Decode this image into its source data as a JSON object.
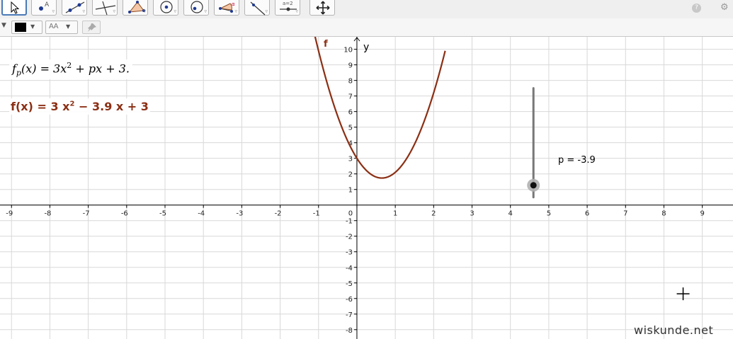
{
  "toolbar": {
    "tools": [
      {
        "name": "move-tool",
        "icon": "cursor-arrow-icon",
        "active": true
      },
      {
        "name": "point-tool",
        "icon": "point-icon"
      },
      {
        "name": "line-tool",
        "icon": "line-through-points-icon"
      },
      {
        "name": "perpendicular-tool",
        "icon": "perpendicular-line-icon"
      },
      {
        "name": "polygon-tool",
        "icon": "polygon-icon"
      },
      {
        "name": "circle-tool",
        "icon": "circle-center-point-icon"
      },
      {
        "name": "circle-three-points-tool",
        "icon": "circle-icon"
      },
      {
        "name": "angle-tool",
        "icon": "angle-icon"
      },
      {
        "name": "reflect-tool",
        "icon": "reflect-line-icon"
      },
      {
        "name": "slider-tool",
        "icon": "slider-icon"
      },
      {
        "name": "move-graphics-tool",
        "icon": "move-arrows-icon"
      }
    ],
    "help_symbol": "?",
    "settings_symbol": "⚙"
  },
  "stylebar": {
    "toggle_symbol": "▼",
    "color": "#000000",
    "text_style_label": "AA",
    "caret": "▼",
    "pin_icon": "pin-icon"
  },
  "algebra": {
    "formula": {
      "f": "f",
      "sub": "p",
      "x_open": "(x) = 3x",
      "exp": "2",
      "rest": " + px + 3."
    },
    "function": {
      "lhs": "f(x)  =  3 x",
      "exp": "2",
      "rest": " − 3.9 x + 3"
    }
  },
  "graph": {
    "x_range": [
      -9.3,
      9.8
    ],
    "y_range": [
      -8.6,
      10.8
    ],
    "x_ticks": [
      -9,
      -8,
      -7,
      -6,
      -5,
      -4,
      -3,
      -2,
      -1,
      0,
      1,
      2,
      3,
      4,
      5,
      6,
      7,
      8,
      9
    ],
    "y_ticks": [
      -8,
      -7,
      -6,
      -5,
      -4,
      -3,
      -2,
      -1,
      1,
      2,
      3,
      4,
      5,
      6,
      7,
      8,
      9,
      10
    ],
    "function_name": "f",
    "y_axis_name": "y",
    "curve": {
      "a": 3,
      "p": -3.9,
      "c": 3,
      "color": "#8b2f14"
    },
    "slider": {
      "x": 4.6,
      "y_min": 0.5,
      "y_max": 7.5,
      "value": -3.9,
      "p_min": -5,
      "p_max": 5,
      "label": "p = -3.9"
    },
    "grid": true,
    "cross_cursor_at": [
      8.5,
      -5.7
    ],
    "axis_color": "#000000",
    "grid_color": "#d8d8d8"
  },
  "watermark": "wiskunde.net"
}
